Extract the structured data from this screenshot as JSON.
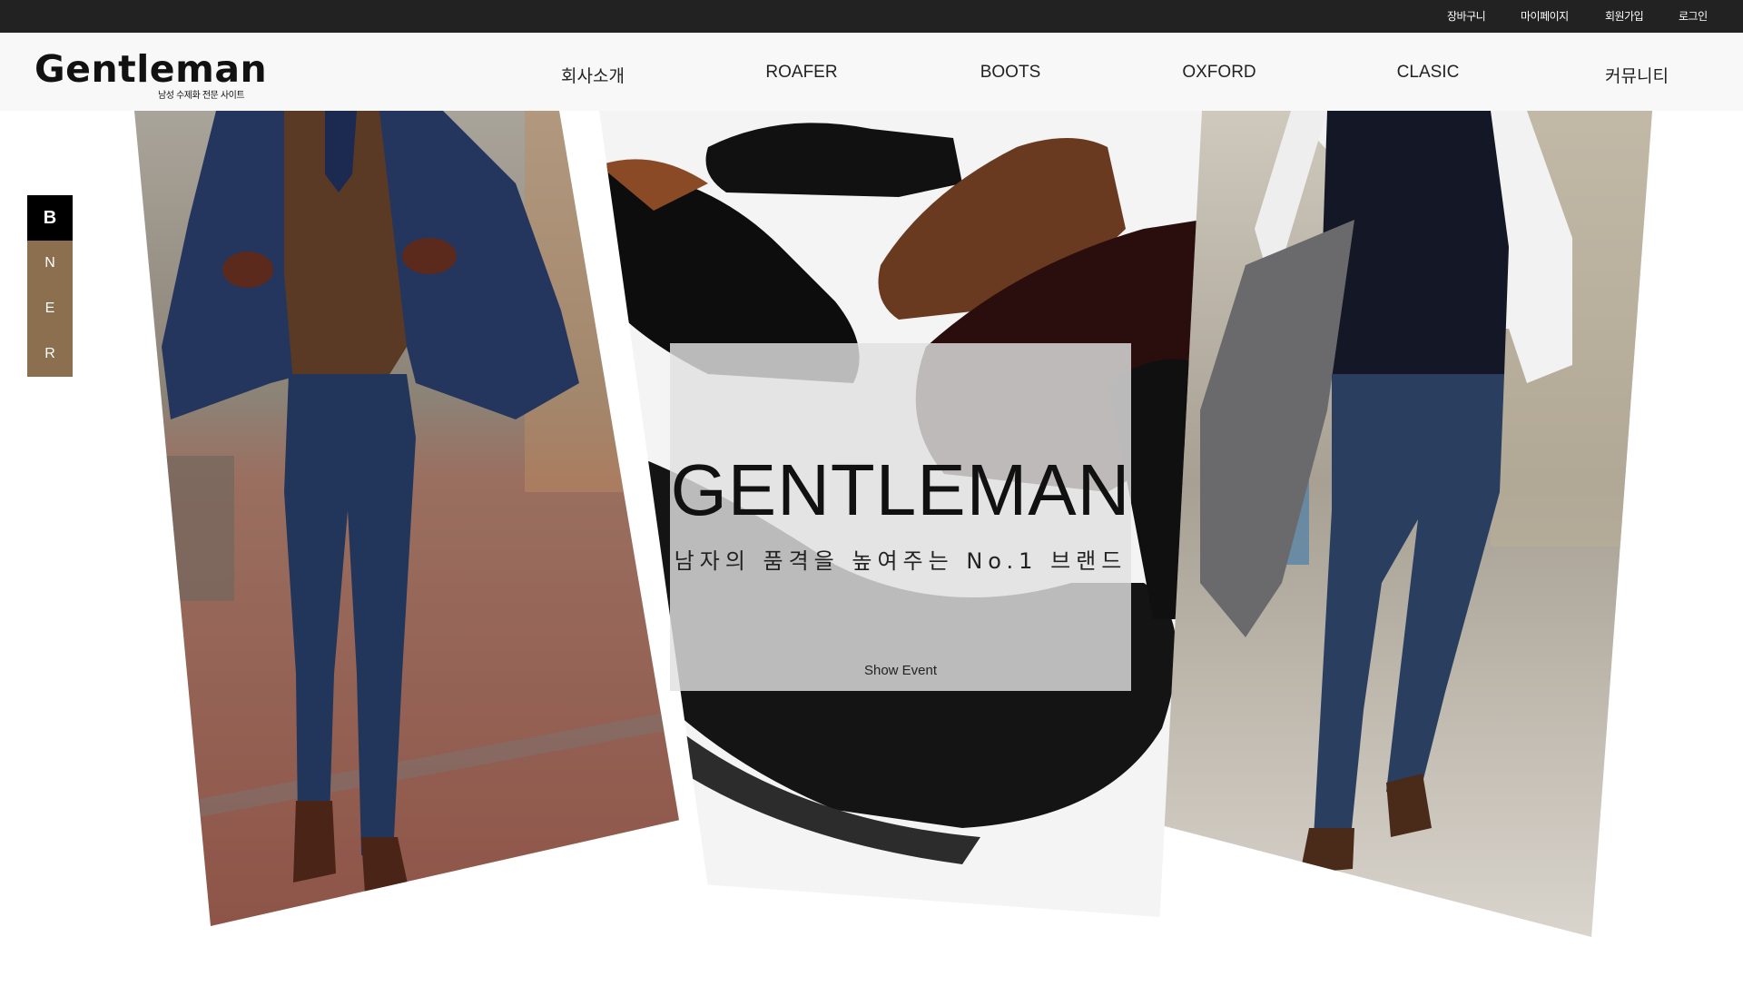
{
  "topbar": {
    "links": [
      "장바구니",
      "마이페이지",
      "회원가입",
      "로그인"
    ]
  },
  "header": {
    "logo_text": "Gentleman",
    "logo_sub": "남성 수제화 전문 사이트",
    "nav": [
      "회사소개",
      "ROAFER",
      "BOOTS",
      "OXFORD",
      "CLASIC",
      "커뮤니티"
    ]
  },
  "side_tabs": {
    "items": [
      "B",
      "N",
      "E",
      "R"
    ],
    "active": "B"
  },
  "hero": {
    "title": "GENTLEMAN",
    "subtitle": "남자의 품격을 높여주는 No.1 브랜드",
    "button": "Show Event"
  },
  "colors": {
    "topbar_bg": "#222222",
    "header_bg": "#f8f8f8",
    "side_tab_bg": "#8b6f4e",
    "side_tab_active_bg": "#000000"
  }
}
